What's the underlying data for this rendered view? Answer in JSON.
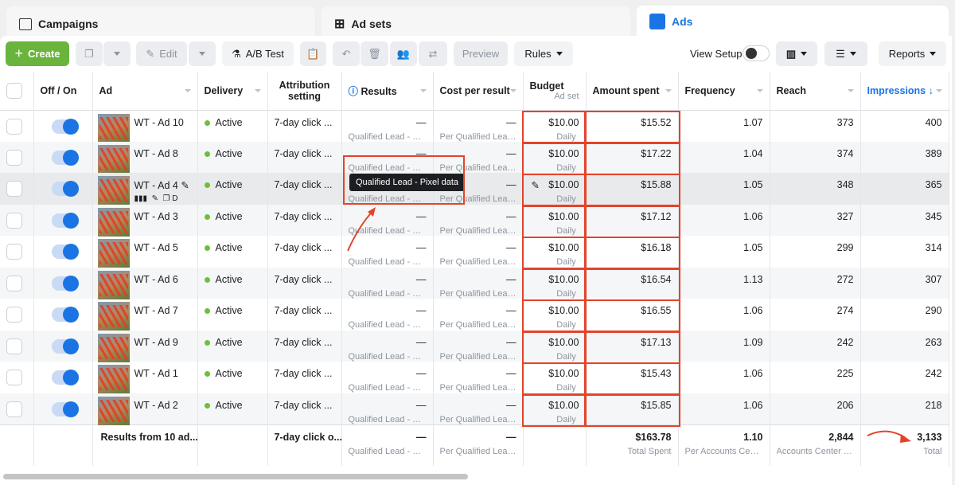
{
  "tabs": [
    {
      "label": "Campaigns",
      "icon": "folder-icon"
    },
    {
      "label": "Ad sets",
      "icon": "grid-icon"
    },
    {
      "label": "Ads",
      "icon": "ad-icon"
    }
  ],
  "toolbar": {
    "create": "Create",
    "edit": "Edit",
    "ab_test": "A/B Test",
    "preview": "Preview",
    "rules": "Rules",
    "view_setup": "View Setup",
    "reports": "Reports"
  },
  "columns": {
    "off_on": "Off / On",
    "ad": "Ad",
    "delivery": "Delivery",
    "attribution": "Attribution setting",
    "results": "Results",
    "cost": "Cost per result",
    "budget": "Budget",
    "budget_sub": "Ad set",
    "amount": "Amount spent",
    "frequency": "Frequency",
    "reach": "Reach",
    "impressions": "Impressions ↓"
  },
  "tooltip": "Qualified Lead - Pixel data",
  "row_common": {
    "delivery": "Active",
    "attribution": "7-day click ...",
    "dash": "—",
    "results_sub": "Qualified Lead - Pi...",
    "cost_sub": "Per Qualified Lead ...",
    "budget_sub": "Daily"
  },
  "rows": [
    {
      "ad": "WT - Ad 10",
      "budget": "$10.00",
      "spent": "$15.52",
      "freq": "1.07",
      "reach": "373",
      "impr": "400"
    },
    {
      "ad": "WT - Ad 8",
      "budget": "$10.00",
      "spent": "$17.22",
      "freq": "1.04",
      "reach": "374",
      "impr": "389"
    },
    {
      "ad": "WT - Ad 4",
      "budget": "$10.00",
      "spent": "$15.88",
      "freq": "1.05",
      "reach": "348",
      "impr": "365"
    },
    {
      "ad": "WT - Ad 3",
      "budget": "$10.00",
      "spent": "$17.12",
      "freq": "1.06",
      "reach": "327",
      "impr": "345"
    },
    {
      "ad": "WT - Ad 5",
      "budget": "$10.00",
      "spent": "$16.18",
      "freq": "1.05",
      "reach": "299",
      "impr": "314"
    },
    {
      "ad": "WT - Ad 6",
      "budget": "$10.00",
      "spent": "$16.54",
      "freq": "1.13",
      "reach": "272",
      "impr": "307"
    },
    {
      "ad": "WT - Ad 7",
      "budget": "$10.00",
      "spent": "$16.55",
      "freq": "1.06",
      "reach": "274",
      "impr": "290"
    },
    {
      "ad": "WT - Ad 9",
      "budget": "$10.00",
      "spent": "$17.13",
      "freq": "1.09",
      "reach": "242",
      "impr": "263"
    },
    {
      "ad": "WT - Ad 1",
      "budget": "$10.00",
      "spent": "$15.43",
      "freq": "1.06",
      "reach": "225",
      "impr": "242"
    },
    {
      "ad": "WT - Ad 2",
      "budget": "$10.00",
      "spent": "$15.85",
      "freq": "1.06",
      "reach": "206",
      "impr": "218"
    }
  ],
  "hover_row_actions": {
    "duplicate_label": "D"
  },
  "footer": {
    "label": "Results from 10 ad...",
    "attribution": "7-day click o...",
    "results": "—",
    "results_sub": "Qualified Lead - Pixe...",
    "cost": "—",
    "cost_sub": "Per Qualified Lead - ...",
    "spent": "$163.78",
    "spent_sub": "Total Spent",
    "freq": "1.10",
    "freq_sub": "Per Accounts Cente...",
    "reach": "2,844",
    "reach_sub": "Accounts Center ac...",
    "impr": "3,133",
    "impr_sub": "Total"
  },
  "colors": {
    "accent": "#1b74e4",
    "create": "#69b43c",
    "annotation": "#e4432a"
  }
}
